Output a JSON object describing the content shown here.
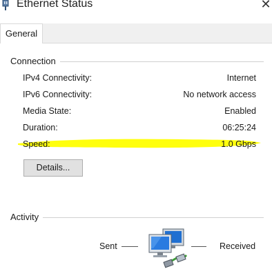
{
  "window": {
    "title": "Ethernet Status",
    "close_glyph": "✕",
    "icon": "network-adapter-icon"
  },
  "tabs": [
    {
      "label": "General",
      "selected": true
    }
  ],
  "connection": {
    "heading": "Connection",
    "rows": [
      {
        "label": "IPv4 Connectivity:",
        "value": "Internet"
      },
      {
        "label": "IPv6 Connectivity:",
        "value": "No network access"
      },
      {
        "label": "Media State:",
        "value": "Enabled"
      },
      {
        "label": "Duration:",
        "value": "06:25:24"
      },
      {
        "label": "Speed:",
        "value": "1.0 Gbps",
        "highlighted": true
      }
    ],
    "details_button": "Details..."
  },
  "activity": {
    "heading": "Activity",
    "sent_label": "Sent",
    "received_label": "Received",
    "icon": "network-computers-icon"
  },
  "colors": {
    "highlight": "#ffff00",
    "button_face": "#e1e1e1",
    "tab_strip": "#f0f0f0"
  }
}
